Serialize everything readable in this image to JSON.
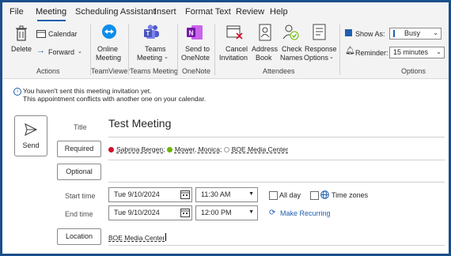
{
  "menu": {
    "tabs": [
      "File",
      "Meeting",
      "Scheduling Assistant",
      "Insert",
      "Format Text",
      "Review",
      "Help"
    ],
    "active_tab": "Meeting"
  },
  "ribbon": {
    "actions": {
      "delete": "Delete",
      "calendar": "Calendar",
      "forward": "Forward",
      "group_label": "Actions"
    },
    "teamviewer": {
      "online_meeting_line1": "Online",
      "online_meeting_line2": "Meeting",
      "group_label": "TeamViewer"
    },
    "teams_meeting": {
      "line1": "Teams",
      "line2": "Meeting",
      "group_label": "Teams Meeting"
    },
    "onenote": {
      "line1": "Send to",
      "line2": "OneNote",
      "group_label": "OneNote"
    },
    "attendees": {
      "cancel_line1": "Cancel",
      "cancel_line2": "Invitation",
      "address_line1": "Address",
      "address_line2": "Book",
      "check_line1": "Check",
      "check_line2": "Names",
      "response_line1": "Response",
      "response_line2": "Options",
      "group_label": "Attendees"
    },
    "options": {
      "show_as_label": "Show As:",
      "show_as_value": "Busy",
      "reminder_label": "Reminder:",
      "reminder_value": "15 minutes",
      "group_label": "Options"
    }
  },
  "info": {
    "line1": "You haven't sent this meeting invitation yet.",
    "line2": "This appointment conflicts with another one on your calendar."
  },
  "form": {
    "send_label": "Send",
    "title_label": "Title",
    "title_value": "Test Meeting",
    "required_label": "Required",
    "optional_label": "Optional",
    "attendees": [
      {
        "name": "Sabrina Bergen",
        "status_color": "#d0102a"
      },
      {
        "name": "Mower, Monica",
        "status_color": "#6bb700"
      },
      {
        "name": "BOE Media Center",
        "status_color": "#a0a0a0"
      }
    ],
    "start_time_label": "Start time",
    "start_date": "Tue 9/10/2024",
    "start_time": "11:30 AM",
    "all_day_label": "All day",
    "time_zones_label": "Time zones",
    "end_time_label": "End time",
    "end_date": "Tue 9/10/2024",
    "end_time": "12:00 PM",
    "make_recurring_label": "Make Recurring",
    "location_label": "Location",
    "location_value": "BOE Media Center"
  }
}
